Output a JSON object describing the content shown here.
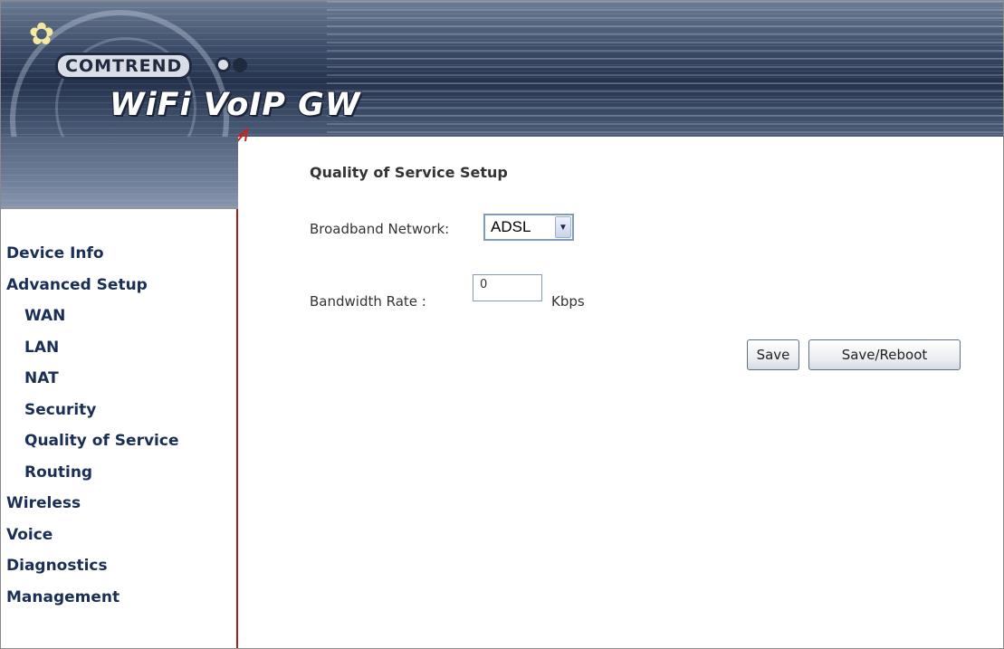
{
  "header": {
    "brand": "COMTREND",
    "product": "WiFi VoIP GW",
    "logo_icon": "flower-logo-icon"
  },
  "sidebar": {
    "items": [
      {
        "label": "Device Info",
        "level": 0
      },
      {
        "label": "Advanced Setup",
        "level": 0
      },
      {
        "label": "WAN",
        "level": 1
      },
      {
        "label": "LAN",
        "level": 1
      },
      {
        "label": "NAT",
        "level": 1
      },
      {
        "label": "Security",
        "level": 1
      },
      {
        "label": "Quality of Service",
        "level": 1
      },
      {
        "label": "Routing",
        "level": 1
      },
      {
        "label": "Wireless",
        "level": 0
      },
      {
        "label": "Voice",
        "level": 0
      },
      {
        "label": "Diagnostics",
        "level": 0
      },
      {
        "label": "Management",
        "level": 0
      }
    ]
  },
  "main": {
    "title": "Quality of Service Setup",
    "broadband_label": "Broadband Network:",
    "broadband_value": "ADSL",
    "bandwidth_label": "Bandwidth Rate :",
    "bandwidth_value": "0",
    "bandwidth_unit": "Kbps",
    "save_label": "Save",
    "save_reboot_label": "Save/Reboot"
  },
  "colors": {
    "menu_text": "#1a2f56",
    "sidebar_border": "#b01818",
    "banner_dark": "#24324c"
  }
}
